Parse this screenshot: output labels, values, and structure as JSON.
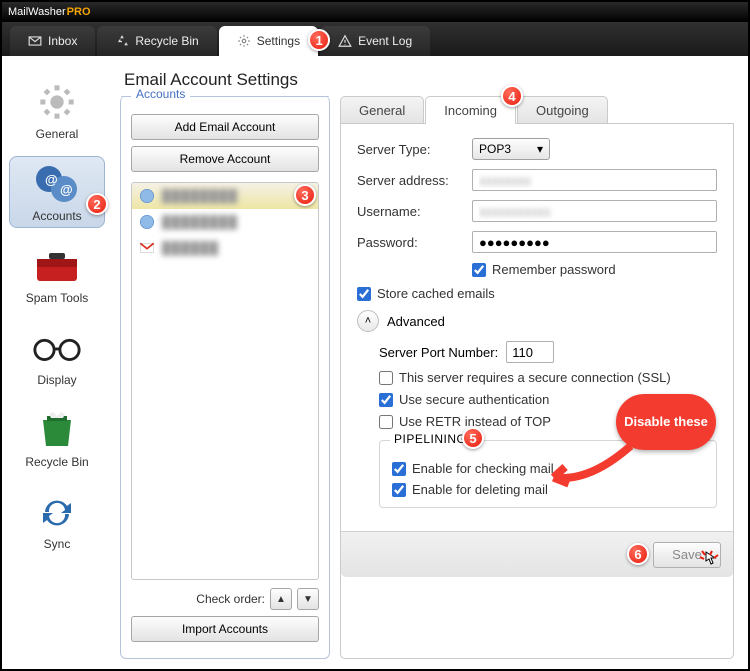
{
  "app": {
    "name": "MailWasher",
    "suffix": "PRO"
  },
  "mainTabs": {
    "inbox": "Inbox",
    "recycle": "Recycle Bin",
    "settings": "Settings",
    "eventlog": "Event Log"
  },
  "sidebar": {
    "general": "General",
    "accounts": "Accounts",
    "spam": "Spam Tools",
    "display": "Display",
    "recycle": "Recycle Bin",
    "sync": "Sync"
  },
  "panelTitle": "Email Account Settings",
  "accountsPanel": {
    "label": "Accounts",
    "addBtn": "Add Email Account",
    "removeBtn": "Remove Account",
    "checkOrder": "Check order:",
    "importBtn": "Import Accounts"
  },
  "subtabs": {
    "general": "General",
    "incoming": "Incoming",
    "outgoing": "Outgoing"
  },
  "fields": {
    "serverType": "Server Type:",
    "serverTypeValue": "POP3",
    "serverAddress": "Server address:",
    "username": "Username:",
    "password": "Password:",
    "passwordValue": "●●●●●●●●●",
    "remember": "Remember password",
    "storeCached": "Store cached emails",
    "advanced": "Advanced",
    "port": "Server Port Number:",
    "portValue": "110",
    "ssl": "This server requires a secure connection (SSL)",
    "secureAuth": "Use secure authentication",
    "retr": "Use RETR instead of TOP",
    "pipelining": "PIPELINING",
    "enableCheck": "Enable for checking mail",
    "enableDelete": "Enable for deleting mail",
    "save": "Save"
  },
  "callout": "Disable these",
  "badges": {
    "b1": "1",
    "b2": "2",
    "b3": "3",
    "b4": "4",
    "b5": "5",
    "b6": "6"
  }
}
